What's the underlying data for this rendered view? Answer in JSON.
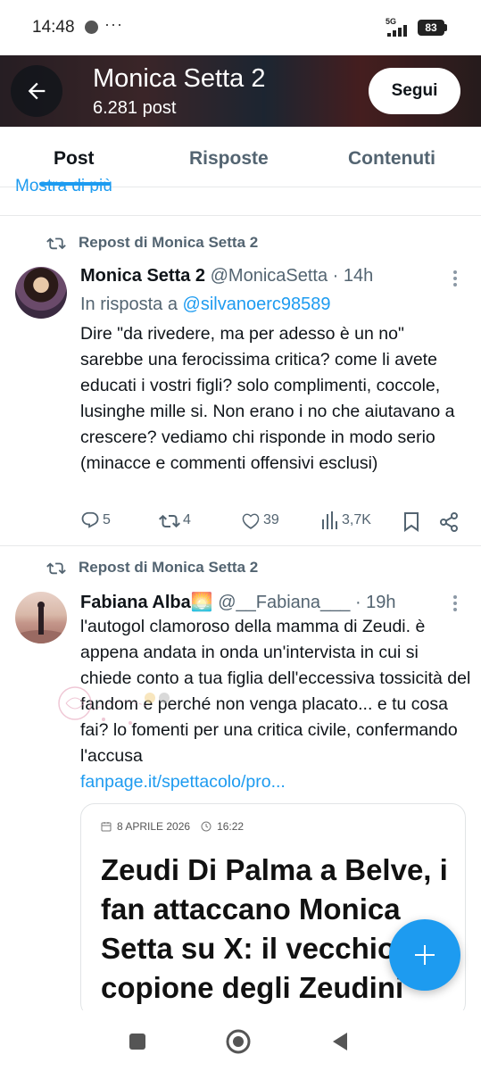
{
  "status_bar": {
    "time": "14:48",
    "more_dots": "···",
    "network": "5G",
    "battery": "83"
  },
  "profile": {
    "name": "Monica Setta 2",
    "post_count": "6.281 post",
    "follow_label": "Segui"
  },
  "tabs": [
    {
      "label": "Post",
      "active": true
    },
    {
      "label": "Risposte",
      "active": false
    },
    {
      "label": "Contenuti",
      "active": false
    }
  ],
  "clipped_text": "Mostra di più",
  "posts": [
    {
      "repost_label": "Repost di Monica Setta 2",
      "author": "Monica Setta 2",
      "handle": "@MonicaSetta",
      "time": "· 14h",
      "reply_prefix": "In risposta a",
      "reply_to": "@silvanoerc98589",
      "text": "Dire \"da rivedere, ma per adesso è un no\" sarebbe una ferocissima critica? come li avete educati i vostri figli? solo complimenti, coccole, lusinghe mille si. Non erano i no che aiutavano a crescere? vediamo chi risponde in modo serio (minacce e commenti offensivi esclusi)",
      "replies": "5",
      "reposts": "4",
      "likes": "39",
      "views": "3,7K"
    },
    {
      "repost_label": "Repost di Monica Setta 2",
      "author": "Fabiana Alba",
      "author_emoji": "🌅",
      "handle": "@__Fabiana___",
      "time": "· 19h",
      "text": "l'autogol clamoroso della mamma di Zeudi. è appena andata in onda un'intervista in cui si chiede conto a tua figlia dell'eccessiva tossicità del fandom e perché non venga placato... e tu cosa fai? lo fomenti per una critica civile, confermando l'accusa",
      "link": "fanpage.it/spettacolo/pro...",
      "article": {
        "date": "8 APRILE 2026",
        "time": "16:22",
        "title": "Zeudi Di Palma a Belve, i fan attaccano Monica Setta su X: il vecchio copione degli Zeudini"
      }
    }
  ],
  "colors": {
    "accent": "#1d9bf0",
    "text_primary": "#0f1419",
    "text_secondary": "#536471"
  }
}
